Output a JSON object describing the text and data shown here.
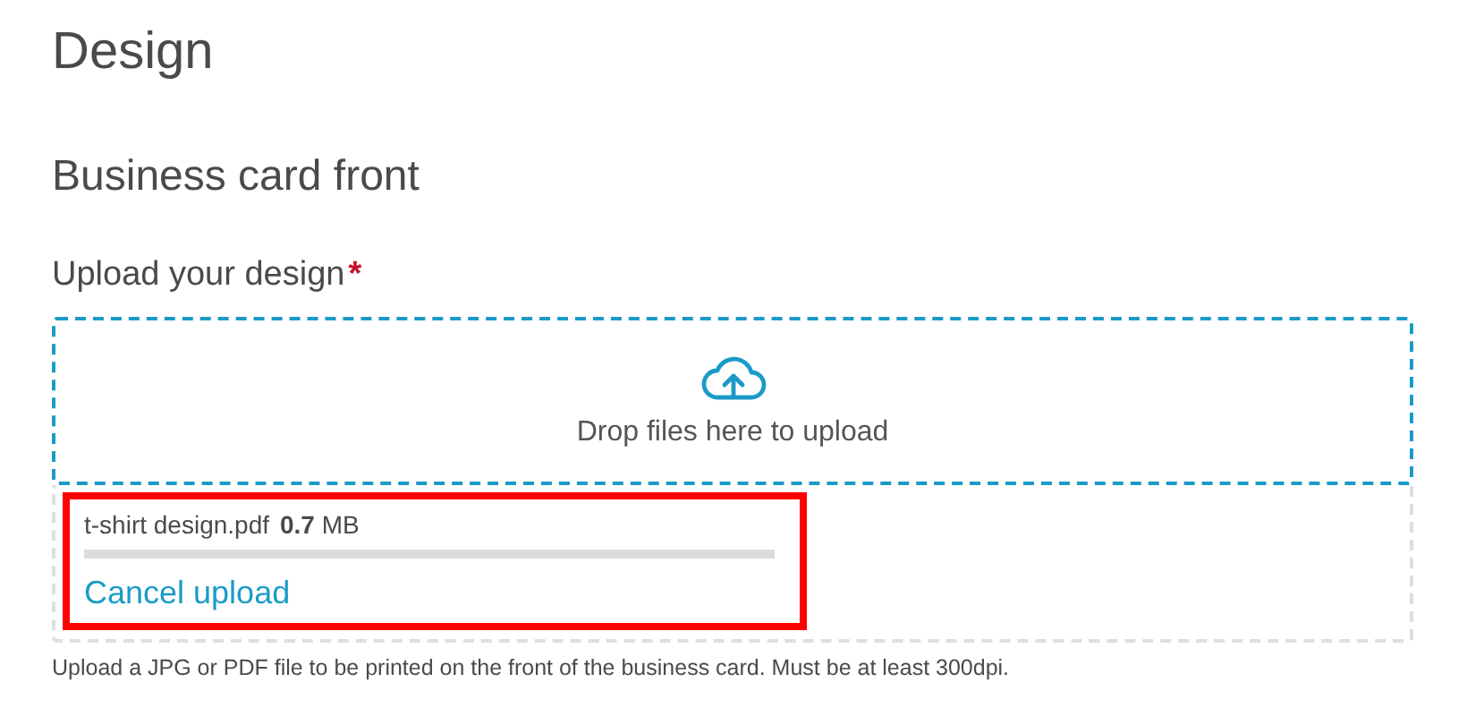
{
  "page_title": "Design",
  "section_title": "Business card front",
  "upload": {
    "label": "Upload your design",
    "required": true,
    "required_mark": "*",
    "dropzone_text": "Drop files here to upload",
    "files": [
      {
        "name": "t-shirt design.pdf",
        "size": "**0.7** MB",
        "level": 0,
        "action": "Cancel upload",
        "highlighted": true
      }
    ],
    "help": "Upload a JPG or PDF file to be printed on the front of the business card. Must be at least 300dpi."
  }
}
